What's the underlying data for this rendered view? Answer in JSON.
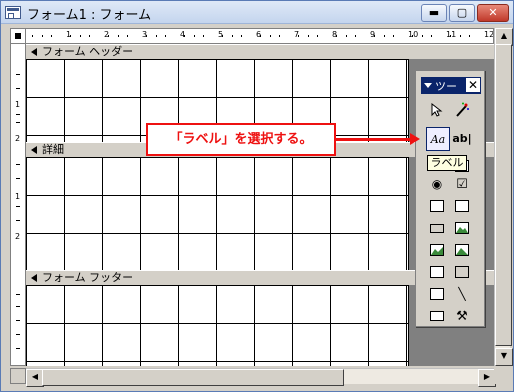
{
  "window": {
    "title": "フォーム1 : フォーム",
    "min_glyph": "▬",
    "max_glyph": "▢",
    "close_glyph": "✕"
  },
  "ruler": {
    "numbers": [
      "1",
      "2",
      "3",
      "4",
      "5",
      "6",
      "7",
      "8",
      "9",
      "10",
      "11",
      "12"
    ],
    "vertical_numbers": [
      "1",
      "2",
      "1",
      "2"
    ]
  },
  "sections": {
    "header": "フォーム ヘッダー",
    "detail": "詳細",
    "footer": "フォーム フッター"
  },
  "toolbox": {
    "title": "ツー",
    "close_label": "✕",
    "label_tool_glyph": "Aa",
    "textbox_tool_glyph": "ab|",
    "checkbox_glyph": "☑",
    "option_glyph": "◉",
    "line_glyph": "╲",
    "wizard_glyph": "⚒"
  },
  "tooltip": {
    "text": "ラベル"
  },
  "callout": {
    "text": "「ラベル」を選択する。"
  },
  "colors": {
    "accent": "#e11111",
    "titlebar": "#0a246a"
  }
}
